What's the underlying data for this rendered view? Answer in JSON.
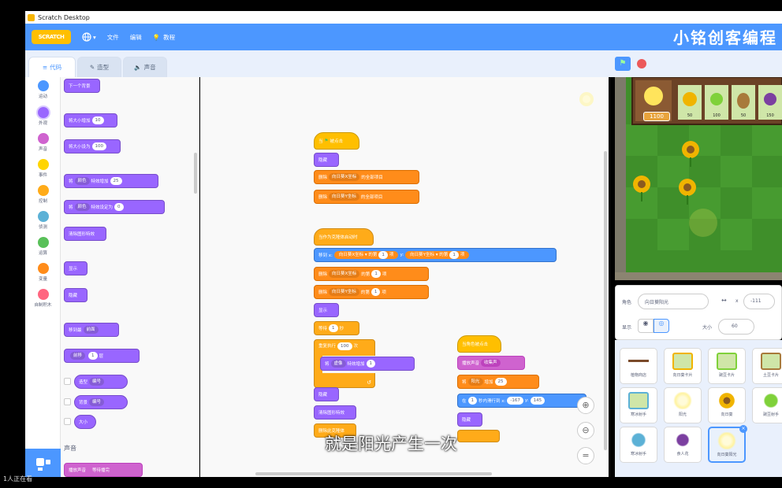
{
  "window": {
    "title": "Scratch Desktop"
  },
  "menubar": {
    "logo": "SCRATCH",
    "file": "文件",
    "edit": "编辑",
    "tutorials": "教程",
    "brand": "小铭创客编程"
  },
  "tabs": {
    "code": "代码",
    "costumes": "造型",
    "sounds": "声音"
  },
  "categories": [
    {
      "label": "运动",
      "color": "#4c97ff"
    },
    {
      "label": "外观",
      "color": "#9966ff"
    },
    {
      "label": "声音",
      "color": "#cf63cf"
    },
    {
      "label": "事件",
      "color": "#ffd500"
    },
    {
      "label": "控制",
      "color": "#ffab19"
    },
    {
      "label": "侦测",
      "color": "#5cb1d6"
    },
    {
      "label": "运算",
      "color": "#59c059"
    },
    {
      "label": "变量",
      "color": "#ff8c1a"
    },
    {
      "label": "自制积木",
      "color": "#ff6680"
    }
  ],
  "palette": {
    "next_backdrop": "下一个背景",
    "change_size": "将大小增加",
    "change_size_val": "10",
    "set_size": "将大小设为",
    "set_size_val": "100",
    "change_effect_a": "将",
    "effect_color": "颜色",
    "change_effect_b": "特效增加",
    "change_effect_val": "25",
    "set_effect_b": "特效设定为",
    "set_effect_val": "0",
    "clear_effects": "清除图形特效",
    "show": "显示",
    "hide": "隐藏",
    "go_to_layer": "移到最",
    "layer_front": "前面",
    "go_layer": "前移",
    "go_layer_val": "1",
    "layers": "层",
    "costume": "造型",
    "number": "编号",
    "backdrop": "背景",
    "name": "编号",
    "size": "大小",
    "sound_heading": "声音",
    "play_until_done": "播放声音",
    "play_until_done_b": "等待播完"
  },
  "script1": {
    "hat": "当",
    "hat_b": "被点击",
    "hide": "隐藏",
    "delete_all_a": "删除",
    "list_x": "向日葵X坐标",
    "delete_all_b": "的全部项目",
    "list_y": "向日葵Y坐标"
  },
  "script2": {
    "hat": "当作为克隆体启动时",
    "goto": "移到 x:",
    "item_of": "的第",
    "item_idx": "1",
    "item_unit": "项",
    "goto_y": "y:",
    "delete": "删除",
    "delete_b": "的第",
    "delete_idx": "1",
    "delete_unit": "项",
    "show": "显示",
    "wait": "等待",
    "wait_val": "1",
    "wait_unit": "秒",
    "repeat": "重复执行",
    "repeat_val": "100",
    "repeat_unit": "次",
    "change": "将",
    "effect": "虚像",
    "change_b": "特效增加",
    "change_val": "1",
    "hide": "隐藏",
    "clear": "清除图形特效",
    "delete_clone": "删除此克隆体"
  },
  "script3": {
    "hat": "当角色被点击",
    "play": "播放声音",
    "sound": "收集声",
    "change": "将",
    "var": "阳光",
    "change_b": "增加",
    "change_val": "25",
    "glide": "在",
    "glide_val": "1",
    "glide_b": "秒内滑行到 x:",
    "x_val": "-167",
    "y": "y:",
    "y_val": "145",
    "hide": "隐藏"
  },
  "stage": {
    "sun_count": "1100",
    "costs": [
      "50",
      "100",
      "50",
      "150"
    ]
  },
  "sprite_info": {
    "label_sprite": "角色",
    "sprite_name": "向日葵阳光",
    "x_label": "x",
    "x_val": "-111",
    "show_label": "显示",
    "size_label": "大小",
    "size_val": "60"
  },
  "sprites": [
    "植物商店",
    "向日葵卡片",
    "豌豆卡片",
    "土豆卡片",
    "寒冰射手",
    "阳光",
    "向日葵",
    "豌豆射手",
    "寒冰射手",
    "食人花",
    "向日葵阳光"
  ],
  "subtitle": "就是阳光产生一次",
  "viewers": "1人正在看"
}
